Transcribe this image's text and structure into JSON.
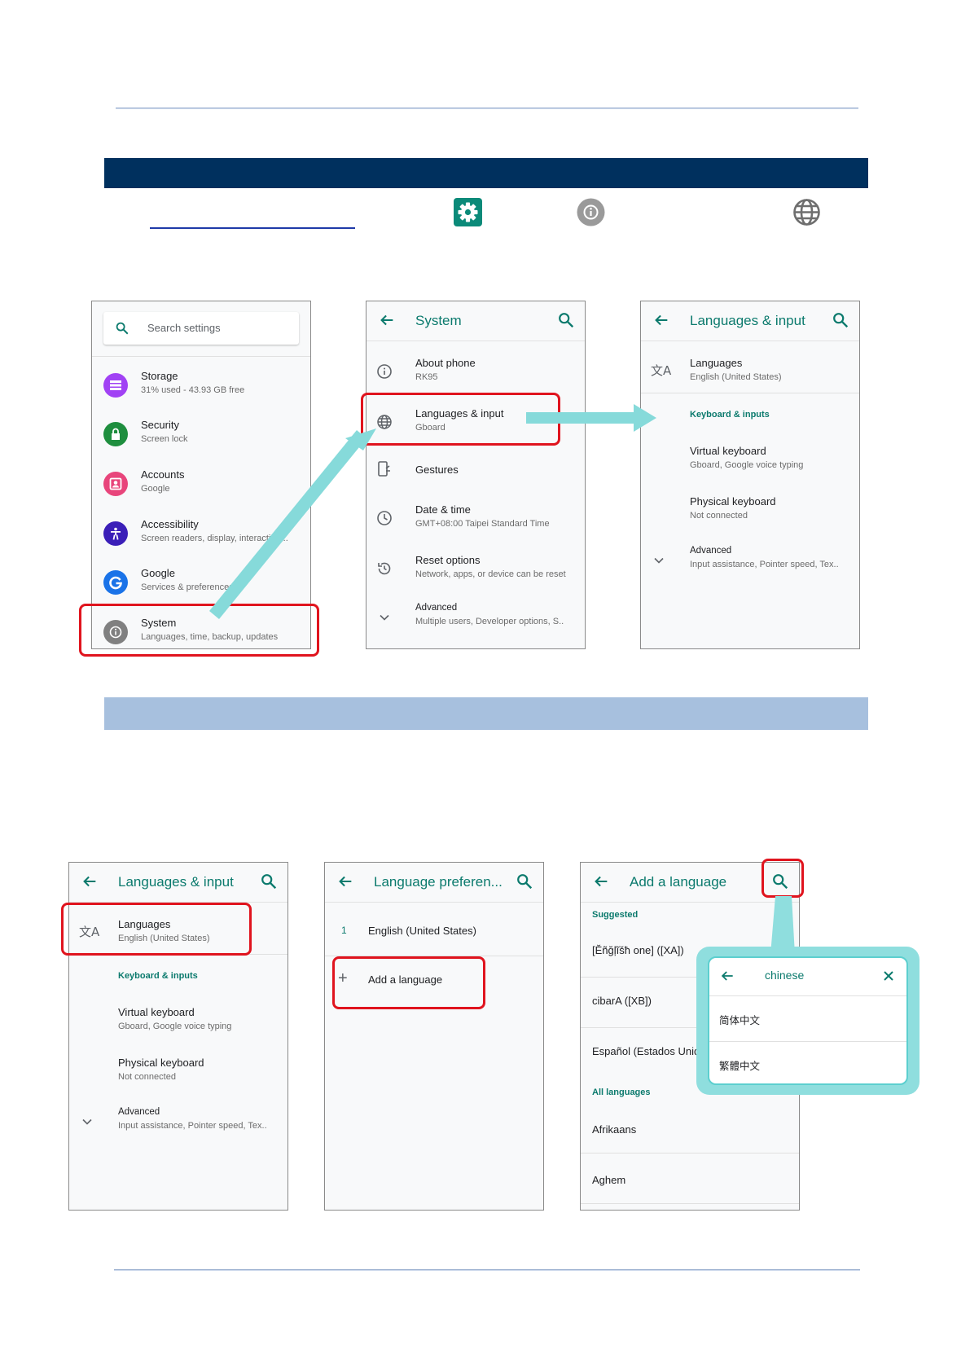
{
  "icons": {
    "settings_gear": "gear-icon",
    "info": "info-icon",
    "globe": "globe-icon"
  },
  "colors": {
    "header_band": "#00305e",
    "sub_band": "#a7c0de",
    "accent_teal": "#0b7a6d",
    "highlight_red": "#e0141e",
    "arrow_cyan": "#86dada"
  },
  "screen1": {
    "search_placeholder": "Search settings",
    "items": [
      {
        "title": "Storage",
        "subtitle": "31% used - 43.93 GB free",
        "icon": "storage-icon",
        "color": "#a142f4"
      },
      {
        "title": "Security",
        "subtitle": "Screen lock",
        "icon": "lock-icon",
        "color": "#1e8e3e"
      },
      {
        "title": "Accounts",
        "subtitle": "Google",
        "icon": "account-icon",
        "color": "#e8457b"
      },
      {
        "title": "Accessibility",
        "subtitle": "Screen readers, display, interaction ..",
        "icon": "accessibility-icon",
        "color": "#3b1fb8"
      },
      {
        "title": "Google",
        "subtitle": "Services & preferences",
        "icon": "google-icon",
        "color": "#1a73e8"
      },
      {
        "title": "System",
        "subtitle": "Languages, time, backup, updates",
        "icon": "info-icon",
        "color": "#808080"
      }
    ]
  },
  "screen2": {
    "title": "System",
    "items": [
      {
        "title": "About phone",
        "subtitle": "RK95"
      },
      {
        "title": "Languages & input",
        "subtitle": "Gboard"
      },
      {
        "title": "Gestures",
        "subtitle": ""
      },
      {
        "title": "Date & time",
        "subtitle": "GMT+08:00 Taipei Standard Time"
      },
      {
        "title": "Reset options",
        "subtitle": "Network, apps, or device can be reset"
      },
      {
        "title": "Advanced",
        "subtitle": "Multiple users, Developer options, S.."
      }
    ]
  },
  "screen3": {
    "title": "Languages & input",
    "languages_title": "Languages",
    "languages_sub": "English (United States)",
    "category": "Keyboard & inputs",
    "virtual_title": "Virtual keyboard",
    "virtual_sub": "Gboard, Google voice typing",
    "physical_title": "Physical keyboard",
    "physical_sub": "Not connected",
    "advanced_title": "Advanced",
    "advanced_sub": "Input assistance, Pointer speed, Tex.."
  },
  "screen4": {
    "title": "Languages & input",
    "languages_title": "Languages",
    "languages_sub": "English (United States)",
    "category": "Keyboard & inputs",
    "virtual_title": "Virtual keyboard",
    "virtual_sub": "Gboard, Google voice typing",
    "physical_title": "Physical keyboard",
    "physical_sub": "Not connected",
    "advanced_title": "Advanced",
    "advanced_sub": "Input assistance, Pointer speed, Tex.."
  },
  "screen5": {
    "title": "Language preferen...",
    "item_number": "1",
    "item_language": "English (United States)",
    "add_label": "Add a language"
  },
  "screen6": {
    "title": "Add a language",
    "suggested_label": "Suggested",
    "suggested": [
      "[Ĕñğļĩšħ one] ([XA])",
      "cibarA ([XB])",
      "Español (Estados Unidos)"
    ],
    "all_label": "All languages",
    "all": [
      "Afrikaans",
      "Aghem"
    ]
  },
  "popup": {
    "query": "chinese",
    "results": [
      "简体中文",
      "繁體中文"
    ]
  }
}
